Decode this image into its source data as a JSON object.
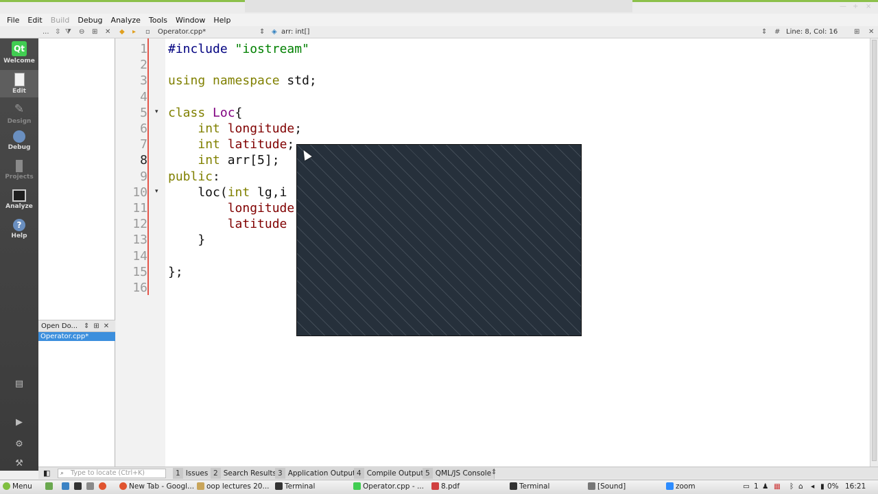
{
  "menubar": {
    "items": [
      {
        "label": "File",
        "enabled": true
      },
      {
        "label": "Edit",
        "enabled": true
      },
      {
        "label": "Build",
        "enabled": false
      },
      {
        "label": "Debug",
        "enabled": true
      },
      {
        "label": "Analyze",
        "enabled": true
      },
      {
        "label": "Tools",
        "enabled": true
      },
      {
        "label": "Window",
        "enabled": true
      },
      {
        "label": "Help",
        "enabled": true
      }
    ]
  },
  "toolbar": {
    "ellipsis": "...",
    "file_name": "Operator.cpp*",
    "symbol": "arr: int[]",
    "hash": "#",
    "position": "Line: 8, Col: 16"
  },
  "modes": {
    "welcome": "Welcome",
    "edit": "Edit",
    "design": "Design",
    "debug": "Debug",
    "projects": "Projects",
    "analyze": "Analyze",
    "help": "Help"
  },
  "open_documents": {
    "title": "Open Do...",
    "files": [
      "Operator.cpp*"
    ]
  },
  "editor": {
    "current_line": 8,
    "line_numbers": [
      "1",
      "2",
      "3",
      "4",
      "5",
      "6",
      "7",
      "8",
      "9",
      "10",
      "11",
      "12",
      "13",
      "14",
      "15",
      "16"
    ],
    "lines": [
      "#include \"iostream\"",
      "",
      "using namespace std;",
      "",
      "class Loc{",
      "    int longitude;",
      "    int latitude;",
      "    int arr[5];",
      "public:",
      "    loc(int lg,i",
      "        longitude",
      "        latitude",
      "    }",
      "",
      "};",
      ""
    ]
  },
  "output_bar": {
    "locator_placeholder": "Type to locate (Ctrl+K)",
    "tabs": [
      {
        "num": "1",
        "label": "Issues"
      },
      {
        "num": "2",
        "label": "Search Results"
      },
      {
        "num": "3",
        "label": "Application Output"
      },
      {
        "num": "4",
        "label": "Compile Output"
      },
      {
        "num": "5",
        "label": "QML/JS Console"
      }
    ]
  },
  "taskbar": {
    "menu_label": "Menu",
    "tasks": [
      {
        "label": "New Tab - Googl...",
        "icon": "chrome-icon"
      },
      {
        "label": "oop lectures 20...",
        "icon": "folder-icon"
      },
      {
        "label": "Terminal",
        "icon": "terminal-icon"
      },
      {
        "label": "Operator.cpp - ...",
        "icon": "qtcreator-icon"
      },
      {
        "label": "8.pdf",
        "icon": "pdf-icon"
      },
      {
        "label": "Terminal",
        "icon": "terminal-icon"
      },
      {
        "label": "[Sound]",
        "icon": "sound-icon"
      },
      {
        "label": "zoom",
        "icon": "zoom-icon"
      }
    ],
    "workspace": "1",
    "battery": "0%",
    "clock": "16:21"
  }
}
